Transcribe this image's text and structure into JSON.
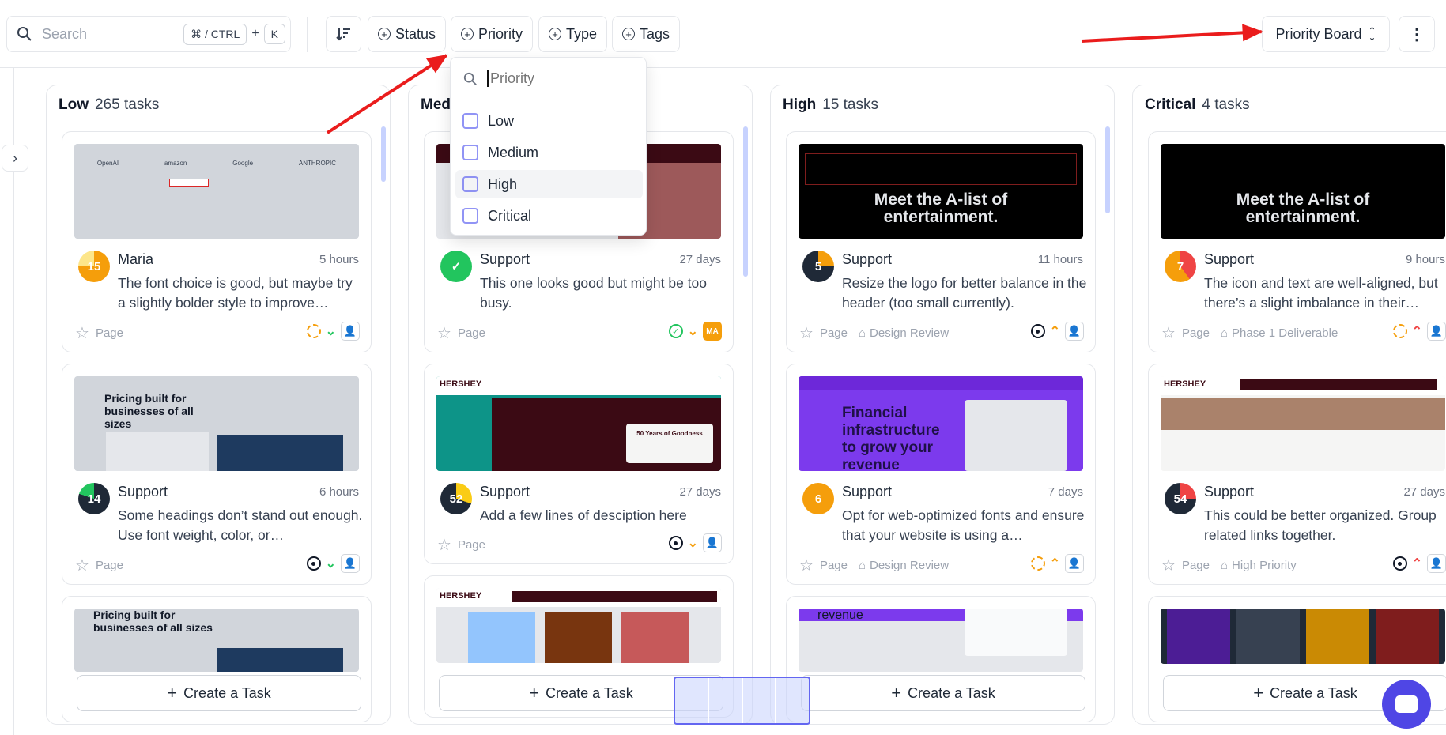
{
  "toolbar": {
    "search_placeholder": "Search",
    "shortcut_mod": "⌘ / CTRL",
    "shortcut_plus": "+",
    "shortcut_key": "K",
    "filters": [
      {
        "label": "Status",
        "icon": "plus-circle-icon"
      },
      {
        "label": "Priority",
        "icon": "plus-circle-icon"
      },
      {
        "label": "Type",
        "icon": "plus-circle-icon"
      },
      {
        "label": "Tags",
        "icon": "plus-circle-icon"
      }
    ],
    "board_select": "Priority Board"
  },
  "priority_dropdown": {
    "placeholder": "Priority",
    "options": [
      "Low",
      "Medium",
      "High",
      "Critical"
    ],
    "highlighted": "High"
  },
  "columns": [
    {
      "name": "Low",
      "count": "265 tasks",
      "cards": [
        {
          "avatar": "15",
          "avatar_color": "#f59e0b",
          "author": "Maria",
          "time": "5 hours",
          "desc": "The font choice is good, but maybe try a slightly bolder style to improve…",
          "page": "Page",
          "tag": "",
          "status": "dashed",
          "priority": "low"
        },
        {
          "avatar": "14",
          "avatar_color": "#1f2937",
          "author": "Support",
          "time": "6 hours",
          "desc": "Some headings don’t stand out enough. Use font weight, color, or…",
          "page": "Page",
          "tag": "",
          "status": "dot",
          "priority": "low"
        }
      ],
      "thumb3_text": "Pricing built for businesses of all sizes",
      "create_label": "Create a Task"
    },
    {
      "name": "Medium",
      "count": "",
      "cards": [
        {
          "avatar": "✓",
          "avatar_color": "#22c55e",
          "author": "Support",
          "time": "27 days",
          "desc": "This one looks good but might be too busy.",
          "page": "Page",
          "tag": "",
          "status": "check",
          "priority": "medium",
          "assignee": "MA"
        },
        {
          "avatar": "52",
          "avatar_color": "#1f2937",
          "author": "Support",
          "time": "27 days",
          "desc": "Add a few lines of desciption here",
          "page": "Page",
          "tag": "",
          "status": "dot",
          "priority": "medium"
        }
      ],
      "create_label": "Create a Task"
    },
    {
      "name": "High",
      "count": "15 tasks",
      "cards": [
        {
          "avatar": "5",
          "avatar_color": "#1f2937",
          "author": "Support",
          "time": "11 hours",
          "desc": "Resize the logo for better balance in the header (too small currently).",
          "page": "Page",
          "tag": "Design Review",
          "status": "dot",
          "priority": "high"
        },
        {
          "avatar": "6",
          "avatar_color": "#f59e0b",
          "author": "Support",
          "time": "7 days",
          "desc": "Opt for web-optimized fonts and ensure that your website is using a…",
          "page": "Page",
          "tag": "Design Review",
          "status": "dashed",
          "priority": "high"
        }
      ],
      "thumb1_text": "Meet the A-list of entertainment.",
      "thumb2_text": "Financial infrastructure to grow your revenue",
      "thumb3_text": "revenue",
      "create_label": "Create a Task"
    },
    {
      "name": "Critical",
      "count": "4 tasks",
      "cards": [
        {
          "avatar": "7",
          "avatar_color": "#f59e0b",
          "author": "Support",
          "time": "9 hours",
          "desc": "The icon and text are well-aligned, but there’s a slight imbalance in their…",
          "page": "Page",
          "tag": "Phase 1 Deliverable",
          "status": "dashed",
          "priority": "critical"
        },
        {
          "avatar": "54",
          "avatar_color": "#1f2937",
          "author": "Support",
          "time": "27 days",
          "desc": "This could be better organized. Group related links together.",
          "page": "Page",
          "tag": "High Priority",
          "status": "dot",
          "priority": "critical"
        }
      ],
      "thumb1_text": "Meet the A-list of entertainment.",
      "create_label": "Create a Task"
    }
  ],
  "thumb_low1_logos": [
    "OpenAI",
    "amazon",
    "Google",
    "ANTHROPIC"
  ],
  "thumb_low2_text": "Pricing built for businesses of all sizes",
  "hershey_text": "HERSHEY",
  "hershey_tagline": "50 Years of Goodness",
  "colors": {
    "accent": "#4f46e5",
    "annotation": "#ea1c1c",
    "dashed_status": "#f59e0b",
    "high_priority": "#f59e0b",
    "critical_priority": "#ef4444",
    "low_priority": "#22c55e",
    "medium_priority": "#f59e0b"
  }
}
